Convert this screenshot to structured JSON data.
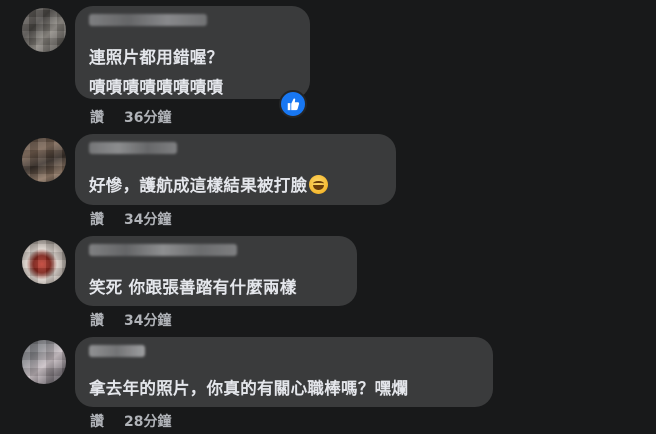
{
  "comments": [
    {
      "lines": [
        "連照片都用錯喔？",
        "嘖嘖嘖嘖嘖嘖嘖嘖"
      ],
      "like_label": "讚",
      "time": "36分鐘",
      "has_reaction": true,
      "reaction_icon": "thumbs-up-icon"
    },
    {
      "lines": [
        "好慘，護航成這樣結果被打臉"
      ],
      "emoji_icon": "rofl-emoji-icon",
      "like_label": "讚",
      "time": "34分鐘"
    },
    {
      "lines": [
        "笑死 你跟張善踏有什麼兩樣"
      ],
      "like_label": "讚",
      "time": "34分鐘"
    },
    {
      "lines": [
        "拿去年的照片，你真的有關心職棒嗎？嘿爛"
      ],
      "like_label": "讚",
      "time": "28分鐘"
    }
  ],
  "colors": {
    "background": "#18191a",
    "bubble": "#3a3b3c",
    "text": "#e4e6eb",
    "meta": "#b0b3b8",
    "like_badge": "#1877f2"
  }
}
